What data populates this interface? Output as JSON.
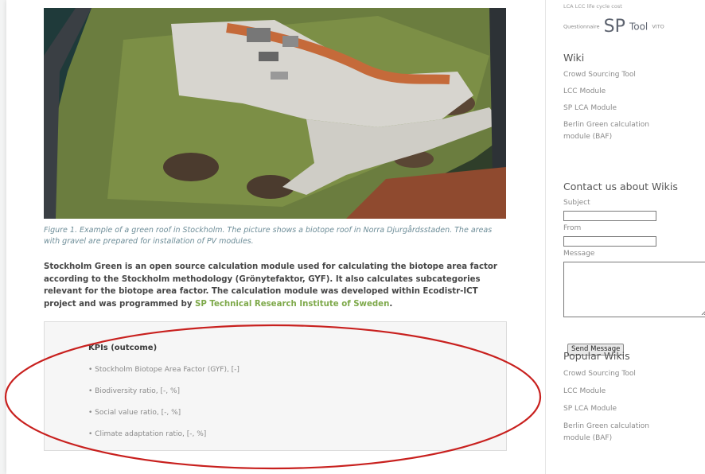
{
  "figure": {
    "caption": "Figure 1. Example of a green roof in Stockholm. The picture shows a biotope roof in Norra Djurgårdsstaden. The areas with gravel are prepared for installation of PV modules."
  },
  "intro": {
    "text": "Stockholm Green is an open source calculation module used for calculating the biotope area factor according to the Stockholm methodology (Grönytefaktor, GYF). It also calculates subcategories relevant for the biotope area factor. The calculation module was developed within Ecodistr-ICT project and was programmed by ",
    "link_text": "SP Technical Research Institute of Sweden",
    "end": "."
  },
  "kpis": {
    "title": "KPIs (outcome)",
    "items": [
      "• Stockholm Biotope Area Factor (GYF), [-]",
      "• Biodiversity ratio, [-, %]",
      "• Social value ratio, [-, %]",
      "• Climate adaptation ratio, [-, %]"
    ]
  },
  "sidebar": {
    "tagline_top": "LCA LCC life cycle cost",
    "tagline_questionnaire": "Questionnaire",
    "tagline_sp": "SP",
    "tagline_tool": "Tool",
    "tagline_vito": "VITO",
    "wiki": {
      "heading": "Wiki",
      "links": [
        "Crowd Sourcing Tool",
        "LCC Module",
        "SP LCA Module",
        "Berlin Green calculation module (BAF)"
      ]
    },
    "contact": {
      "heading": "Contact us about Wikis",
      "subject_label": "Subject",
      "from_label": "From",
      "message_label": "Message",
      "subject_value": "",
      "from_value": "",
      "message_value": "",
      "send_label": "Send Message"
    },
    "popular": {
      "heading": "Popular Wikis",
      "links": [
        "Crowd Sourcing Tool",
        "LCC Module",
        "SP LCA Module",
        "Berlin Green calculation module (BAF)"
      ]
    }
  },
  "colors": {
    "annotation_ellipse": "#c8201e",
    "link_green": "#7ea94a",
    "caption_blue": "#6d8d98"
  }
}
